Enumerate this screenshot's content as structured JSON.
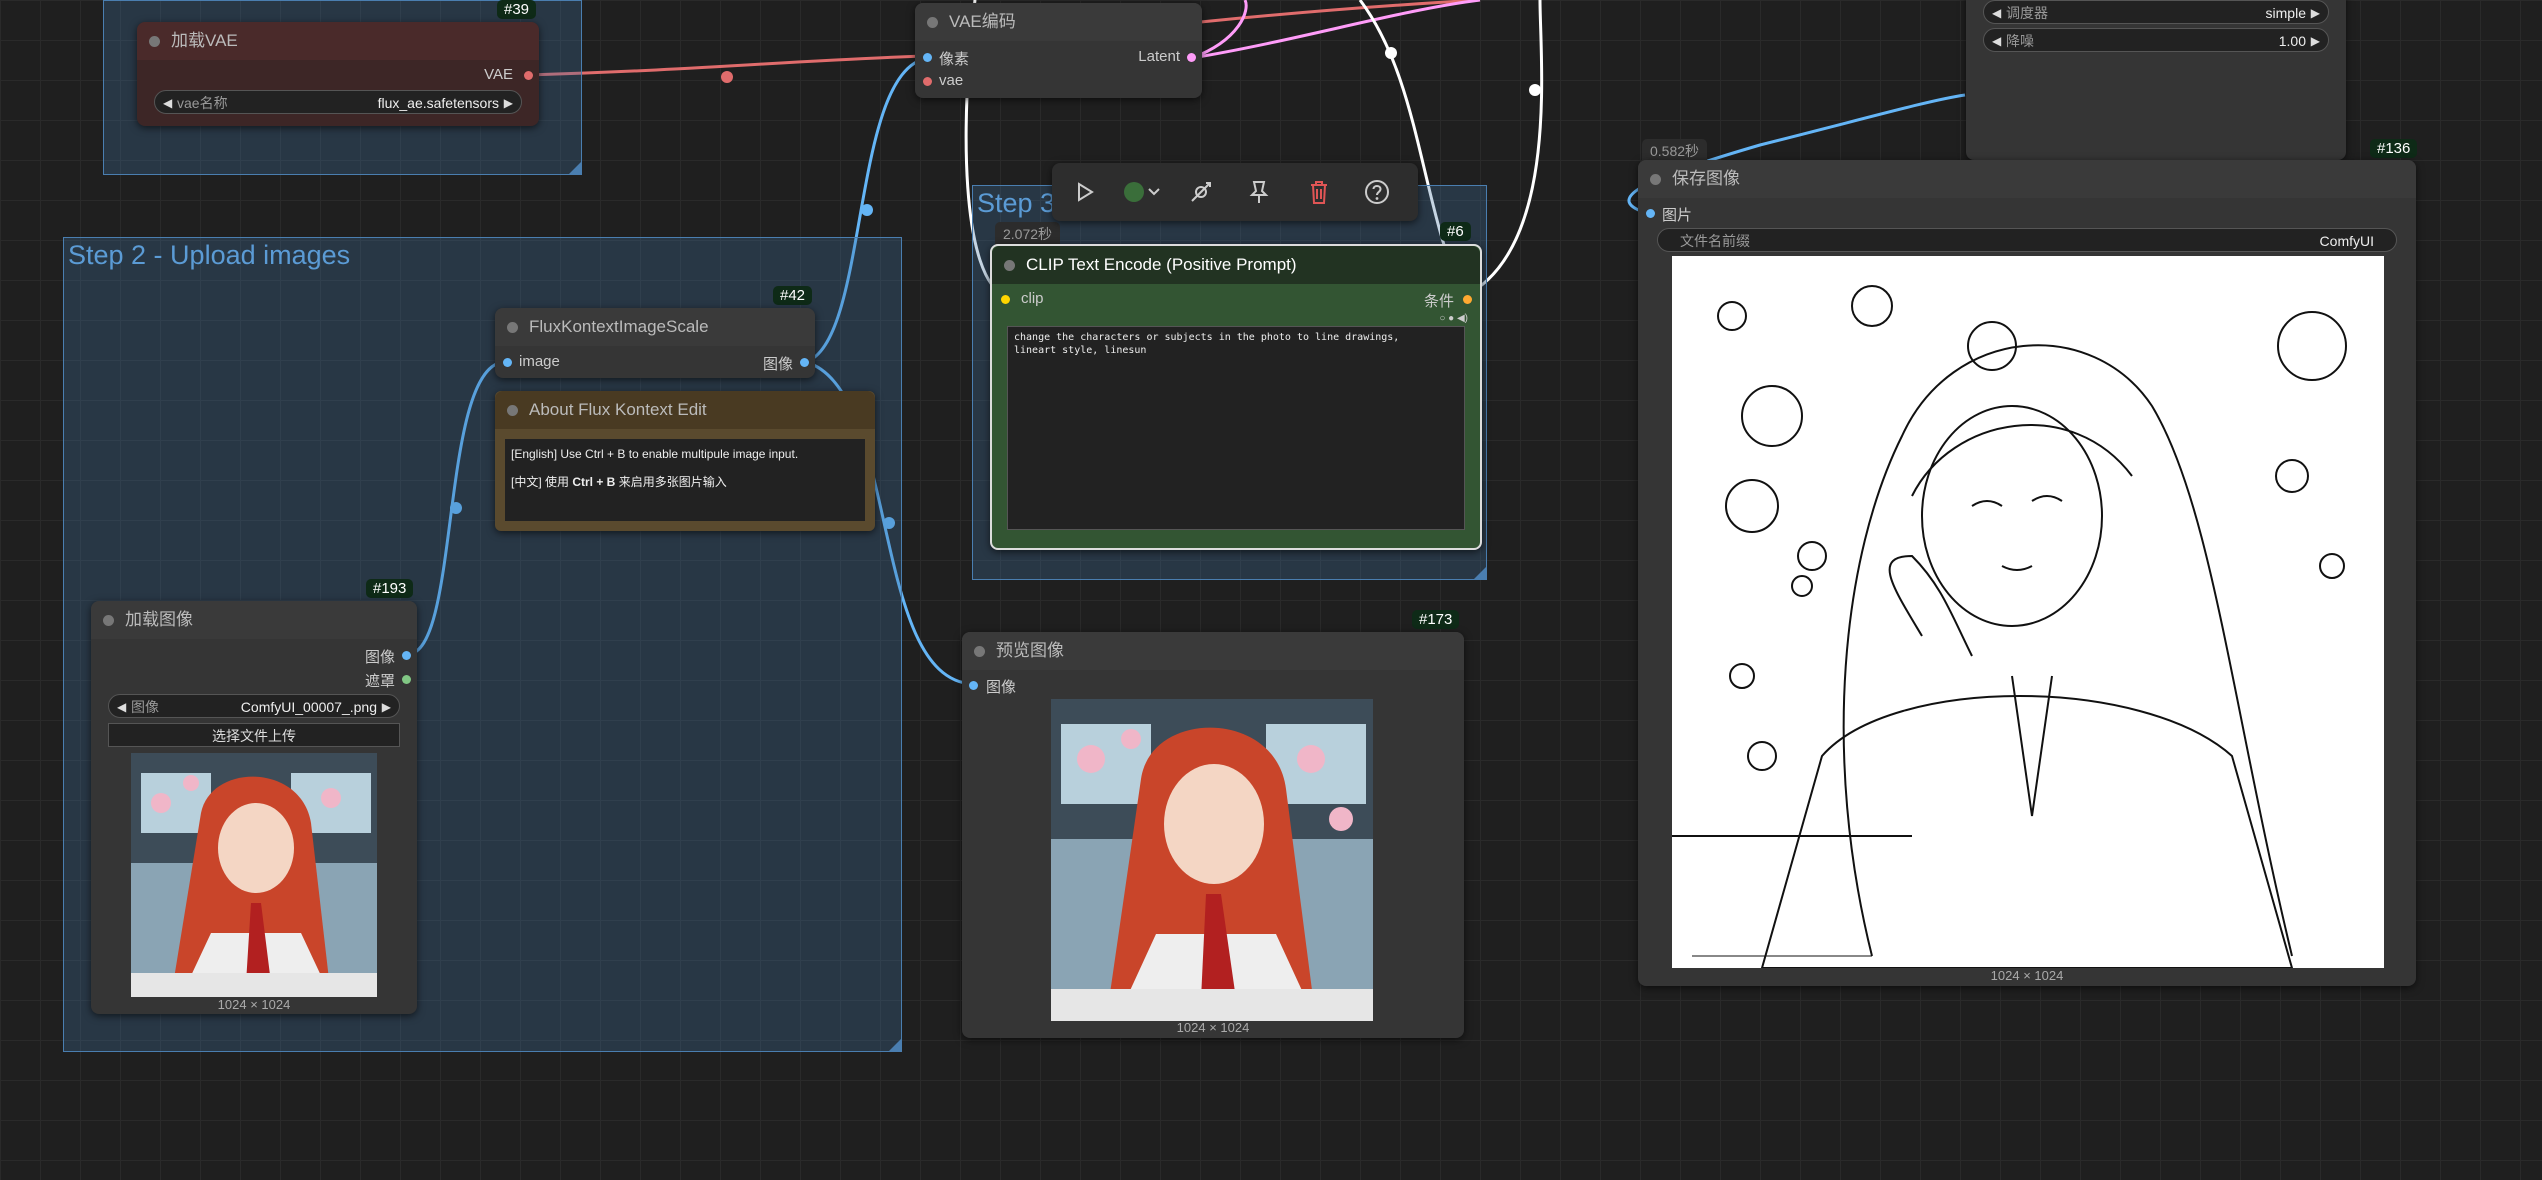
{
  "groups": {
    "step2": {
      "title": "Step 2 - Upload images"
    },
    "step3": {
      "title": "Step 3"
    }
  },
  "nodes": {
    "load_vae": {
      "badge": "#39",
      "title": "加载VAE",
      "output_vae": "VAE",
      "widget_label": "vae名称",
      "widget_value": "flux_ae.safetensors"
    },
    "vae_encode": {
      "title": "VAE编码",
      "input_pixels": "像素",
      "input_vae": "vae",
      "output_latent": "Latent"
    },
    "sampler_partial": {
      "scheduler_label": "调度器",
      "scheduler_value": "simple",
      "denoise_label": "降噪",
      "denoise_value": "1.00"
    },
    "flux_scale": {
      "badge": "#42",
      "title": "FluxKontextImageScale",
      "input_image": "image",
      "output_image": "图像"
    },
    "about": {
      "title": "About Flux Kontext Edit",
      "line_en_prefix": "[English] Use Ctrl + B to enable multipule image input.",
      "line_cn_prefix": "[中文] 使用 ",
      "line_cn_keys": "Ctrl + B",
      "line_cn_suffix": " 来启用多张图片输入"
    },
    "load_image": {
      "badge": "#193",
      "title": "加载图像",
      "output_image": "图像",
      "output_mask": "遮罩",
      "widget_label": "图像",
      "widget_value": "ComfyUI_00007_.png",
      "upload_label": "选择文件上传",
      "image_size": "1024 × 1024"
    },
    "clip_encode": {
      "timer": "2.072秒",
      "badge": "#6",
      "title": "CLIP Text Encode (Positive Prompt)",
      "input_clip": "clip",
      "output_cond": "条件",
      "prompt": "change the characters or subjects in the photo to line drawings,\nlineart style, linesun"
    },
    "preview": {
      "badge": "#173",
      "title": "预览图像",
      "input_image": "图像",
      "image_size": "1024 × 1024"
    },
    "save_image": {
      "timer": "0.582秒",
      "badge": "#136",
      "title": "保存图像",
      "input_image": "图片",
      "widget_label": "文件名前缀",
      "widget_value": "ComfyUI",
      "image_size": "1024 × 1024"
    }
  },
  "toolbar": {
    "icons": [
      "play-icon",
      "color-dot-icon",
      "bypass-icon",
      "pin-icon",
      "trash-icon",
      "help-icon"
    ]
  },
  "colors": {
    "link_vae": "#e06c6c",
    "link_image": "#64b5f6",
    "link_latent": "#ff9cf9",
    "link_clip": "#ffffff",
    "link_cond": "#ffa931"
  }
}
